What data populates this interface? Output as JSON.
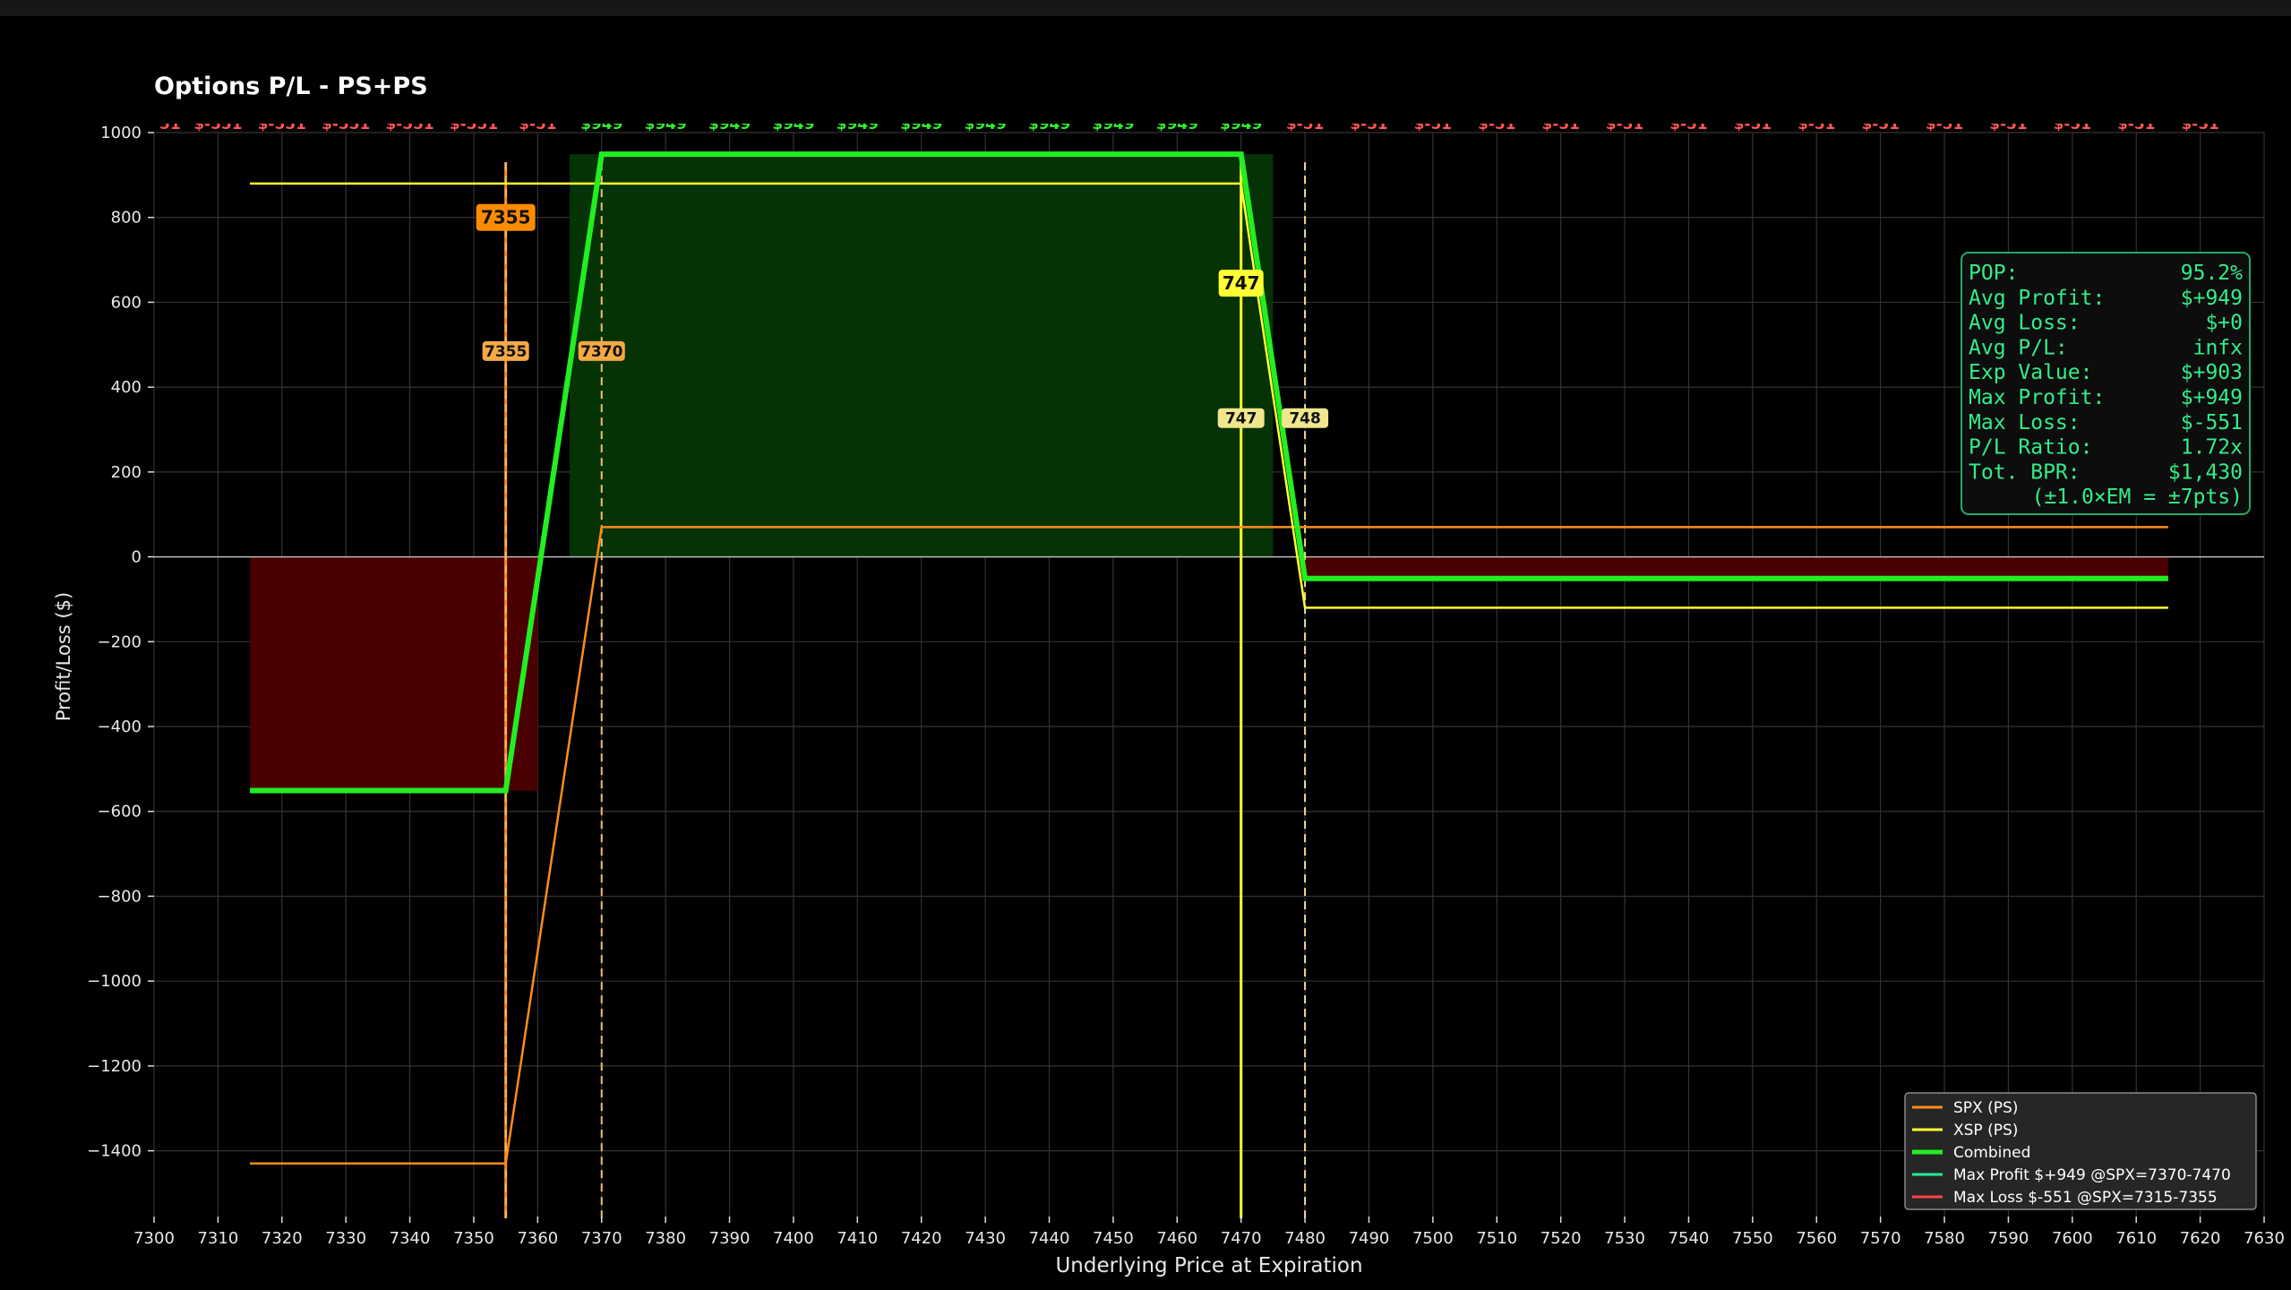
{
  "chart_data": {
    "type": "line",
    "title": "Options P/L - PS+PS",
    "xlabel": "Underlying Price at Expiration",
    "ylabel": "Profit/Loss ($)",
    "xlim": [
      7300,
      7630
    ],
    "ylim": [
      -1555,
      1000
    ],
    "xticks": [
      7300,
      7310,
      7320,
      7330,
      7340,
      7350,
      7360,
      7370,
      7380,
      7390,
      7400,
      7410,
      7420,
      7430,
      7440,
      7450,
      7460,
      7470,
      7480,
      7490,
      7500,
      7510,
      7520,
      7530,
      7540,
      7550,
      7560,
      7570,
      7580,
      7590,
      7600,
      7610,
      7620,
      7630
    ],
    "xtick_labels": [
      "7300",
      "7310",
      "7320",
      "7330",
      "7340",
      "7350",
      "7360",
      "7370",
      "7380",
      "7390",
      "7400",
      "7410",
      "7420",
      "7430",
      "7440",
      "7450",
      "7460",
      "7470",
      "7480",
      "7490",
      "7500",
      "7510",
      "7520",
      "7530",
      "7540",
      "7550",
      "7560",
      "7570",
      "7580",
      "7590",
      "7600",
      "7610",
      "7620",
      "7630"
    ],
    "yticks": [
      1000,
      800,
      600,
      400,
      200,
      0,
      -200,
      -400,
      -600,
      -800,
      -1000,
      -1200,
      -1400
    ],
    "ytick_labels": [
      "1000",
      "800",
      "600",
      "400",
      "200",
      "0",
      "−200",
      "−400",
      "−600",
      "−800",
      "−1000",
      "−1200",
      "−1400"
    ],
    "grid": true,
    "legend_position": "bottom-right",
    "series": [
      {
        "name": "SPX (PS)",
        "color": "#ff8c1a",
        "x": [
          7315,
          7355,
          7370,
          7615
        ],
        "y": [
          -1430,
          -1430,
          70,
          70
        ]
      },
      {
        "name": "XSP (PS)",
        "color": "#ffff33",
        "x": [
          7315,
          7470,
          7480,
          7615
        ],
        "y": [
          880,
          880,
          -120,
          -120
        ]
      },
      {
        "name": "Combined",
        "color": "#22ee22",
        "x": [
          7315,
          7355,
          7370,
          7470,
          7480,
          7615
        ],
        "y": [
          -551,
          -551,
          949,
          949,
          -51,
          -51
        ]
      }
    ],
    "legend": [
      {
        "label": "SPX (PS)",
        "color": "#ff8c1a"
      },
      {
        "label": "XSP (PS)",
        "color": "#ffff33"
      },
      {
        "label": "Combined",
        "color": "#22ee22"
      },
      {
        "label": "Max Profit  $+949 @SPX=7370-7470",
        "color": "#22ee99"
      },
      {
        "label": "Max Loss    $-551 @SPX=7315-7355",
        "color": "#ff4444"
      }
    ],
    "top_labels": {
      "x": [
        7302.5,
        7310,
        7320,
        7330,
        7340,
        7350,
        7360,
        7370,
        7380,
        7390,
        7400,
        7410,
        7420,
        7430,
        7440,
        7450,
        7460,
        7470,
        7480,
        7490,
        7500,
        7510,
        7520,
        7530,
        7540,
        7550,
        7560,
        7570,
        7580,
        7590,
        7600,
        7610,
        7620
      ],
      "text": [
        "51",
        "$-551",
        "$-551",
        "$-551",
        "$-551",
        "$-551",
        "$-51",
        "$949",
        "$949",
        "$949",
        "$949",
        "$949",
        "$949",
        "$949",
        "$949",
        "$949",
        "$949",
        "$949",
        "$-51",
        "$-51",
        "$-51",
        "$-51",
        "$-51",
        "$-51",
        "$-51",
        "$-51",
        "$-51",
        "$-51",
        "$-51",
        "$-51",
        "$-51",
        "$-51",
        "$-51"
      ],
      "profit_color": "#33ee33",
      "loss_color": "#ff5555"
    },
    "strike_lines": [
      {
        "x": 7355,
        "color": "#ff8c1a",
        "style": "solid"
      },
      {
        "x": 7355,
        "color": "#f0c070",
        "style": "dashed"
      },
      {
        "x": 7370,
        "color": "#f0c070",
        "style": "dashed"
      },
      {
        "x": 7470,
        "color": "#ffff33",
        "style": "solid"
      },
      {
        "x": 7480,
        "color": "#f0e090",
        "style": "dashed"
      }
    ],
    "strike_labels": [
      {
        "text": "7355",
        "x": 7355,
        "y": 800,
        "bg": "#ff8c00",
        "size": "large"
      },
      {
        "text": "7355",
        "x": 7355,
        "y": 485,
        "bg": "#f4a944",
        "size": "small"
      },
      {
        "text": "7370",
        "x": 7370,
        "y": 485,
        "bg": "#f4a944",
        "size": "small"
      },
      {
        "text": "747",
        "x": 7470,
        "y": 645,
        "bg": "#ffff33",
        "size": "large"
      },
      {
        "text": "747",
        "x": 7470,
        "y": 327,
        "bg": "#f0e68c",
        "size": "small"
      },
      {
        "text": "748",
        "x": 7480,
        "y": 327,
        "bg": "#f0e68c",
        "size": "small"
      }
    ],
    "profit_region": {
      "x_start": 7365,
      "x_end": 7475,
      "color": "#063306"
    },
    "loss_regions": [
      {
        "x_start": 7315,
        "x_end": 7360,
        "color": "#4a0000"
      },
      {
        "x_start": 7479,
        "x_end": 7615,
        "color": "#4a0000"
      }
    ]
  },
  "stats": {
    "border_color": "#22aa66",
    "text_color": "#33ee88",
    "rows": [
      {
        "label": "POP:",
        "value": "95.2%"
      },
      {
        "label": "Avg Profit:",
        "value": "$+949"
      },
      {
        "label": "Avg Loss:",
        "value": "$+0"
      },
      {
        "label": "Avg P/L:",
        "value": "infx"
      },
      {
        "label": "Exp Value:",
        "value": "$+903"
      },
      {
        "label": "Max Profit:",
        "value": "$+949"
      },
      {
        "label": "Max Loss:",
        "value": "$-551"
      },
      {
        "label": "P/L Ratio:",
        "value": "1.72x"
      },
      {
        "label": "Tot. BPR:",
        "value": "$1,430"
      }
    ],
    "footer": "(±1.0×EM = ±7pts)"
  }
}
